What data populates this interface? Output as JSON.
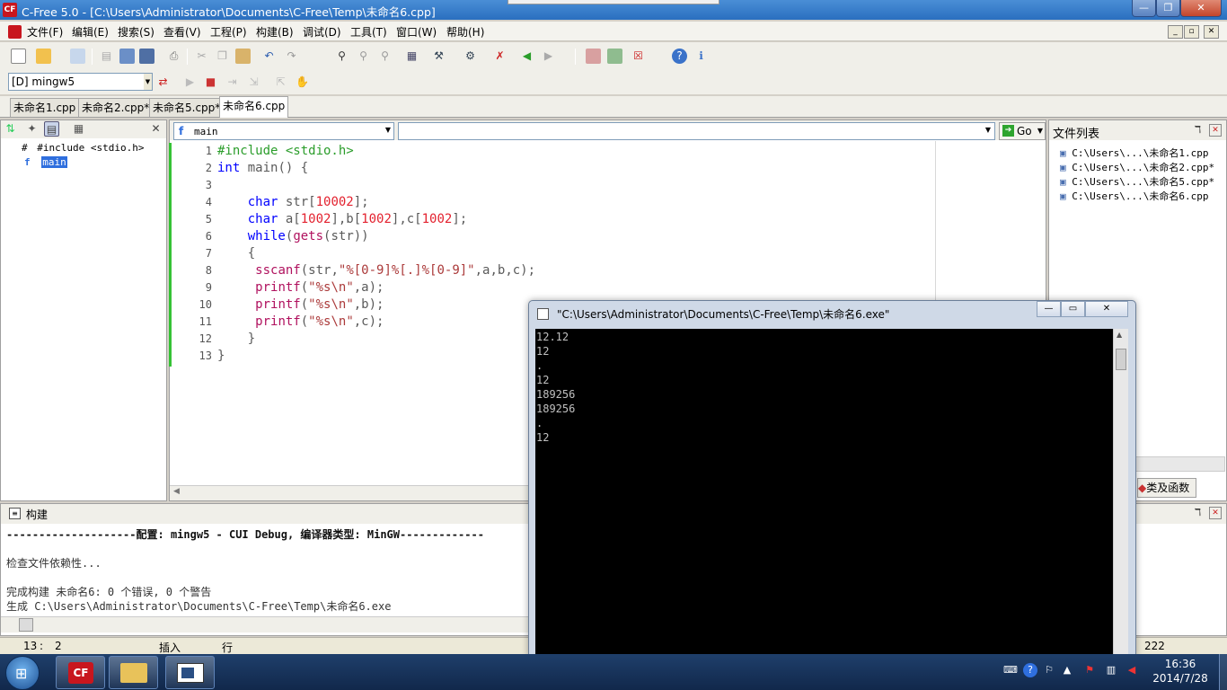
{
  "app": {
    "title": "C-Free 5.0 - [C:\\Users\\Administrator\\Documents\\C-Free\\Temp\\未命名6.cpp]",
    "logo_text": "CF"
  },
  "window_controls": {
    "minimize": "—",
    "maximize": "❐",
    "close": "✕"
  },
  "menu": [
    "文件(F)",
    "编辑(E)",
    "搜索(S)",
    "查看(V)",
    "工程(P)",
    "构建(B)",
    "调试(D)",
    "工具(T)",
    "窗口(W)",
    "帮助(H)"
  ],
  "toolbar": {
    "compiler_select": "[D] mingw5",
    "icons": [
      "new-file-icon",
      "open-folder-icon",
      "project-icon",
      "cut-disabled-icon",
      "save-icon",
      "save-all-icon",
      "print-icon",
      "cut-icon",
      "copy-icon",
      "paste-icon",
      "undo-icon",
      "redo-icon",
      "find-icon",
      "find-next-icon",
      "replace-icon",
      "goto-icon",
      "wand-icon",
      "build-tools-icon",
      "delete-icon",
      "back-arrow-icon",
      "forward-arrow-icon",
      "bookmark-icon",
      "export-icon",
      "close-doc-icon",
      "help-icon",
      "info-icon"
    ]
  },
  "tabs": [
    {
      "label": "未命名1.cpp",
      "active": false
    },
    {
      "label": "未命名2.cpp*",
      "active": false
    },
    {
      "label": "未命名5.cpp*",
      "active": false
    },
    {
      "label": "未命名6.cpp",
      "active": true
    }
  ],
  "left_panel": {
    "tree": [
      {
        "icon": "#",
        "label": "#include <stdio.h>"
      },
      {
        "icon": "f",
        "label": "main",
        "selected": true
      }
    ],
    "close": "✕"
  },
  "editor": {
    "function_combo": "main",
    "go_label": "Go",
    "line_numbers": [
      "1",
      "2",
      "3",
      "4",
      "5",
      "6",
      "7",
      "8",
      "9",
      "10",
      "11",
      "12",
      "13"
    ]
  },
  "right_panel": {
    "title": "文件列表",
    "files": [
      "C:\\Users\\...\\未命名1.cpp",
      "C:\\Users\\...\\未命名2.cpp*",
      "C:\\Users\\...\\未命名5.cpp*",
      "C:\\Users\\...\\未命名6.cpp"
    ],
    "tab_label": "类及函数",
    "pin": "ℸ",
    "close": "✕"
  },
  "build_panel": {
    "title": "构建",
    "lines": [
      "--------------------配置: mingw5 - CUI Debug, 编译器类型: MinGW-------------",
      "",
      "检查文件依赖性...",
      "",
      "完成构建 未命名6: 0 个错误, 0 个警告",
      "生成 C:\\Users\\Administrator\\Documents\\C-Free\\Temp\\未命名6.exe"
    ]
  },
  "status_bar": {
    "line": "13",
    "col": "2",
    "mode": "插入",
    "unit": "行",
    "right": "222"
  },
  "console": {
    "title": "\"C:\\Users\\Administrator\\Documents\\C-Free\\Temp\\未命名6.exe\"",
    "lines": [
      "12.12",
      "12",
      ".",
      "12",
      "189256",
      "189256",
      ".",
      "12"
    ],
    "controls": {
      "minimize": "—",
      "maximize": "▭",
      "close": "✕"
    }
  },
  "taskbar": {
    "time": "16:36",
    "date": "2014/7/28",
    "apps": [
      "cfree-app-icon",
      "explorer-icon",
      "console-app-icon"
    ]
  }
}
